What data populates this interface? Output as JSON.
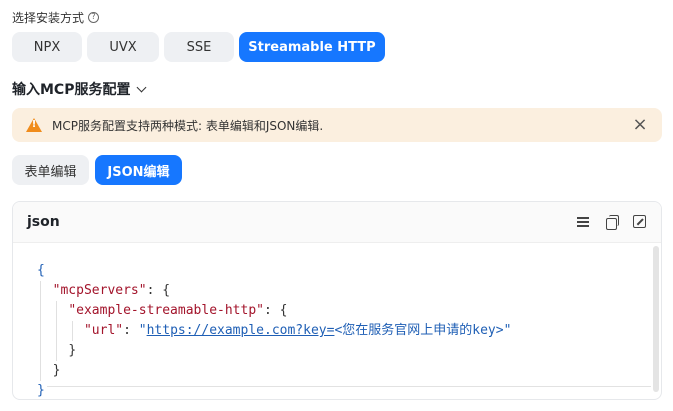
{
  "install": {
    "label": "选择安装方式",
    "help_icon": "?",
    "methods": [
      {
        "label": "NPX",
        "active": false
      },
      {
        "label": "UVX",
        "active": false
      },
      {
        "label": "SSE",
        "active": false
      },
      {
        "label": "Streamable HTTP",
        "active": true
      }
    ]
  },
  "config": {
    "title": "输入MCP服务配置"
  },
  "alert": {
    "text": "MCP服务配置支持两种模式: 表单编辑和JSON编辑.",
    "close": "×"
  },
  "modes": [
    {
      "label": "表单编辑",
      "active": false
    },
    {
      "label": "JSON编辑",
      "active": true
    }
  ],
  "editor": {
    "title": "json",
    "code": {
      "l1": "{",
      "l2_key": "\"mcpServers\"",
      "l2_rest": ": {",
      "l3_key": "\"example-streamable-http\"",
      "l3_rest": ": {",
      "l4_key": "\"url\"",
      "l4_sep": ": ",
      "l4_q1": "\"",
      "l4_link": "https://example.com?key=",
      "l4_tail": "<您在服务官网上申请的key>\"",
      "l5": "}",
      "l6": "}",
      "l7": "}"
    }
  },
  "colors": {
    "accent": "#1677ff",
    "warning": "#f08c1c",
    "alert_bg": "#fbefdf"
  }
}
